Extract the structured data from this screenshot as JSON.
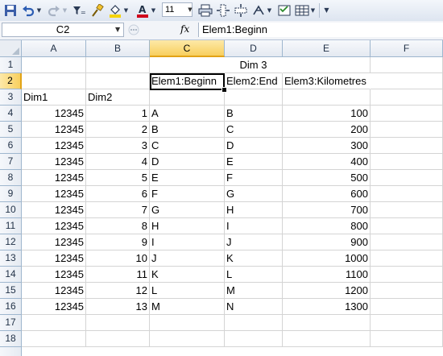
{
  "toolbar": {
    "font_size": "11",
    "icons": [
      "undo-icon",
      "undo-dropdown-icon",
      "redo-icon",
      "redo-dropdown-icon",
      "filter-icon",
      "format-painter-icon",
      "fill-color-icon",
      "fill-color-dropdown-icon",
      "font-color-icon",
      "font-color-dropdown-icon",
      "font-size-dropdown-icon",
      "print-icon",
      "insert-column-icon",
      "insert-row-icon",
      "function-icon",
      "function-dropdown-icon",
      "form-icon",
      "table-icon",
      "table-dropdown-icon",
      "customize-dropdown-icon"
    ],
    "colors": {
      "fill": "#f5d40c",
      "font": "#d0021b"
    }
  },
  "formula_bar": {
    "name_box": "C2",
    "fx_label": "fx",
    "formula": "Elem1:Beginn"
  },
  "grid": {
    "columns": [
      "A",
      "B",
      "C",
      "D",
      "E",
      "F"
    ],
    "rows": [
      "1",
      "2",
      "3",
      "4",
      "5",
      "6",
      "7",
      "8",
      "9",
      "10",
      "11",
      "12",
      "13",
      "14",
      "15",
      "16",
      "17",
      "18"
    ],
    "selected_cell": "C2",
    "header_row1": {
      "dim3": "Dim 3"
    },
    "header_row2": {
      "c": "Elem1:Beginn",
      "d": "Elem2:End",
      "e": "Elem3:Kilometres"
    },
    "header_row3": {
      "a": "Dim1",
      "b": "Dim2"
    },
    "data": [
      [
        "12345",
        "1",
        "A",
        "B",
        "100"
      ],
      [
        "12345",
        "2",
        "B",
        "C",
        "200"
      ],
      [
        "12345",
        "3",
        "C",
        "D",
        "300"
      ],
      [
        "12345",
        "4",
        "D",
        "E",
        "400"
      ],
      [
        "12345",
        "5",
        "E",
        "F",
        "500"
      ],
      [
        "12345",
        "6",
        "F",
        "G",
        "600"
      ],
      [
        "12345",
        "7",
        "G",
        "H",
        "700"
      ],
      [
        "12345",
        "8",
        "H",
        "I",
        "800"
      ],
      [
        "12345",
        "9",
        "I",
        "J",
        "900"
      ],
      [
        "12345",
        "10",
        "J",
        "K",
        "1000"
      ],
      [
        "12345",
        "11",
        "K",
        "L",
        "1100"
      ],
      [
        "12345",
        "12",
        "L",
        "M",
        "1200"
      ],
      [
        "12345",
        "13",
        "M",
        "N",
        "1300"
      ]
    ]
  },
  "colors": {
    "selection_header": "#f8cf5e",
    "gridline": "#d4d4d4",
    "header_border": "#9eb6ce"
  }
}
